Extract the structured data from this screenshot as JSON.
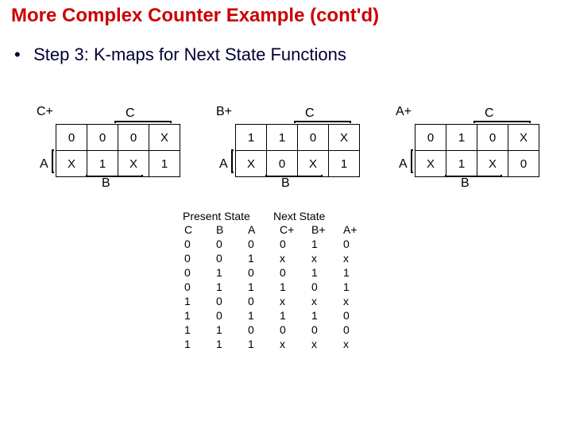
{
  "title": "More Complex Counter Example (cont'd)",
  "bullet": "Step 3: K-maps for Next State Functions",
  "labels": {
    "C": "C",
    "A": "A",
    "B": "B"
  },
  "kmaps": {
    "cplus": {
      "name": "C+",
      "cells": [
        [
          "0",
          "0",
          "0",
          "X"
        ],
        [
          "X",
          "1",
          "X",
          "1"
        ]
      ]
    },
    "bplus": {
      "name": "B+",
      "cells": [
        [
          "1",
          "1",
          "0",
          "X"
        ],
        [
          "X",
          "0",
          "X",
          "1"
        ]
      ]
    },
    "aplus": {
      "name": "A+",
      "cells": [
        [
          "0",
          "1",
          "0",
          "X"
        ],
        [
          "X",
          "1",
          "X",
          "0"
        ]
      ]
    }
  },
  "state_table": {
    "group_headers": {
      "ps": "Present State",
      "ns": "Next State"
    },
    "cols": [
      "C",
      "B",
      "A",
      "C+",
      "B+",
      "A+"
    ],
    "rows": [
      [
        "0",
        "0",
        "0",
        "0",
        "1",
        "0"
      ],
      [
        "0",
        "0",
        "1",
        "x",
        "x",
        "x"
      ],
      [
        "0",
        "1",
        "0",
        "0",
        "1",
        "1"
      ],
      [
        "0",
        "1",
        "1",
        "1",
        "0",
        "1"
      ],
      [
        "1",
        "0",
        "0",
        "x",
        "x",
        "x"
      ],
      [
        "1",
        "0",
        "1",
        "1",
        "1",
        "0"
      ],
      [
        "1",
        "1",
        "0",
        "0",
        "0",
        "0"
      ],
      [
        "1",
        "1",
        "1",
        "x",
        "x",
        "x"
      ]
    ]
  }
}
